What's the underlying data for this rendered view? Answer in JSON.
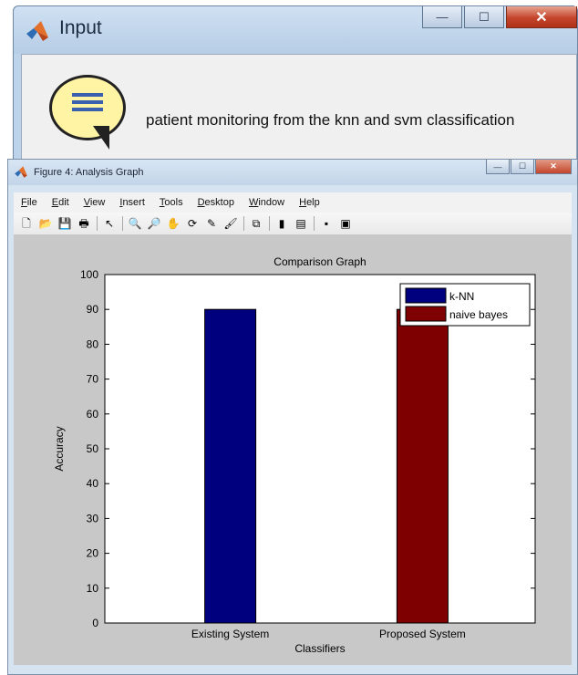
{
  "input_dialog": {
    "title": "Input",
    "message": "patient monitoring from the knn and svm classification",
    "buttons": {
      "minimize": "—",
      "maximize": "☐",
      "close": "✕"
    }
  },
  "figure_window": {
    "title": "Figure 4: Analysis Graph",
    "buttons": {
      "minimize": "—",
      "maximize": "☐",
      "close": "✕"
    },
    "menu": [
      "File",
      "Edit",
      "View",
      "Insert",
      "Tools",
      "Desktop",
      "Window",
      "Help"
    ],
    "toolbar": [
      {
        "name": "new-file-icon",
        "glyph": "🗋"
      },
      {
        "name": "open-folder-icon",
        "glyph": "📂"
      },
      {
        "name": "save-icon",
        "glyph": "💾"
      },
      {
        "name": "print-icon",
        "glyph": "🖶"
      },
      {
        "sep": true
      },
      {
        "name": "pointer-icon",
        "glyph": "↖"
      },
      {
        "sep": true
      },
      {
        "name": "zoom-in-icon",
        "glyph": "🔍"
      },
      {
        "name": "zoom-out-icon",
        "glyph": "🔎"
      },
      {
        "name": "pan-hand-icon",
        "glyph": "✋"
      },
      {
        "name": "rotate-3d-icon",
        "glyph": "⟳"
      },
      {
        "name": "data-cursor-icon",
        "glyph": "✎"
      },
      {
        "name": "brush-icon",
        "glyph": "🖌"
      },
      {
        "sep": true
      },
      {
        "name": "link-plot-icon",
        "glyph": "⧉"
      },
      {
        "sep": true
      },
      {
        "name": "colorbar-icon",
        "glyph": "▮"
      },
      {
        "name": "legend-icon",
        "glyph": "▤"
      },
      {
        "sep": true
      },
      {
        "name": "hide-plot-tools-icon",
        "glyph": "▪"
      },
      {
        "name": "show-plot-tools-icon",
        "glyph": "▣"
      }
    ]
  },
  "chart_data": {
    "type": "bar",
    "title": "Comparison Graph",
    "xlabel": "Classifiers",
    "ylabel": "Accuracy",
    "categories": [
      "Existing System",
      "Proposed System"
    ],
    "ylim": [
      0,
      100
    ],
    "yticks": [
      0,
      10,
      20,
      30,
      40,
      50,
      60,
      70,
      80,
      90,
      100
    ],
    "series": [
      {
        "name": "k-NN",
        "color": "#00007f",
        "values": [
          90,
          null
        ]
      },
      {
        "name": "naive bayes",
        "color": "#7f0000",
        "values": [
          null,
          90
        ]
      }
    ],
    "legend_position": "top-right",
    "grid": false
  }
}
